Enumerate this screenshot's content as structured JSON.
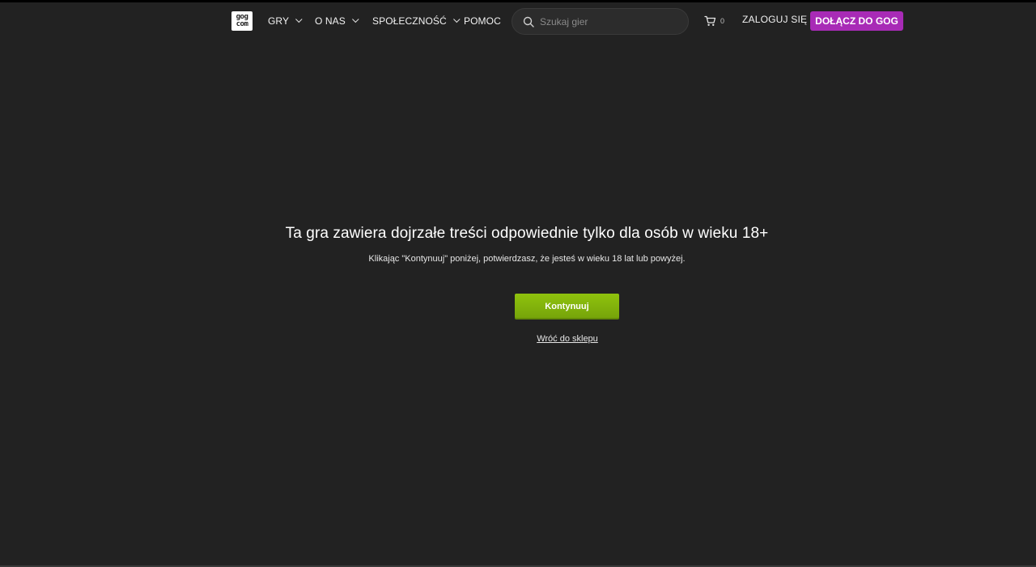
{
  "header": {
    "logo_top": "gog",
    "logo_bottom": "com",
    "nav": [
      {
        "label": "GRY"
      },
      {
        "label": "O NAS"
      },
      {
        "label": "SPOŁECZNOŚĆ"
      },
      {
        "label": "POMOC"
      }
    ],
    "search": {
      "placeholder": "Szukaj gier",
      "value": ""
    },
    "cart_count": "0",
    "login_label": "ZALOGUJ SIĘ",
    "join_label": "DOŁĄCZ DO GOG"
  },
  "age_gate": {
    "title": "Ta gra zawiera dojrzałe treści odpowiednie tylko dla osób w wieku 18+",
    "subtitle": "Klikając \"Kontynuuj\" poniżej, potwierdzasz, że jesteś w wieku 18 lat lub powyżej.",
    "continue_label": "Kontynuuj",
    "back_label": "Wróć do sklepu"
  },
  "colors": {
    "background": "#222222",
    "join_button": "#a82bb6",
    "continue_button": "#86b70c"
  }
}
